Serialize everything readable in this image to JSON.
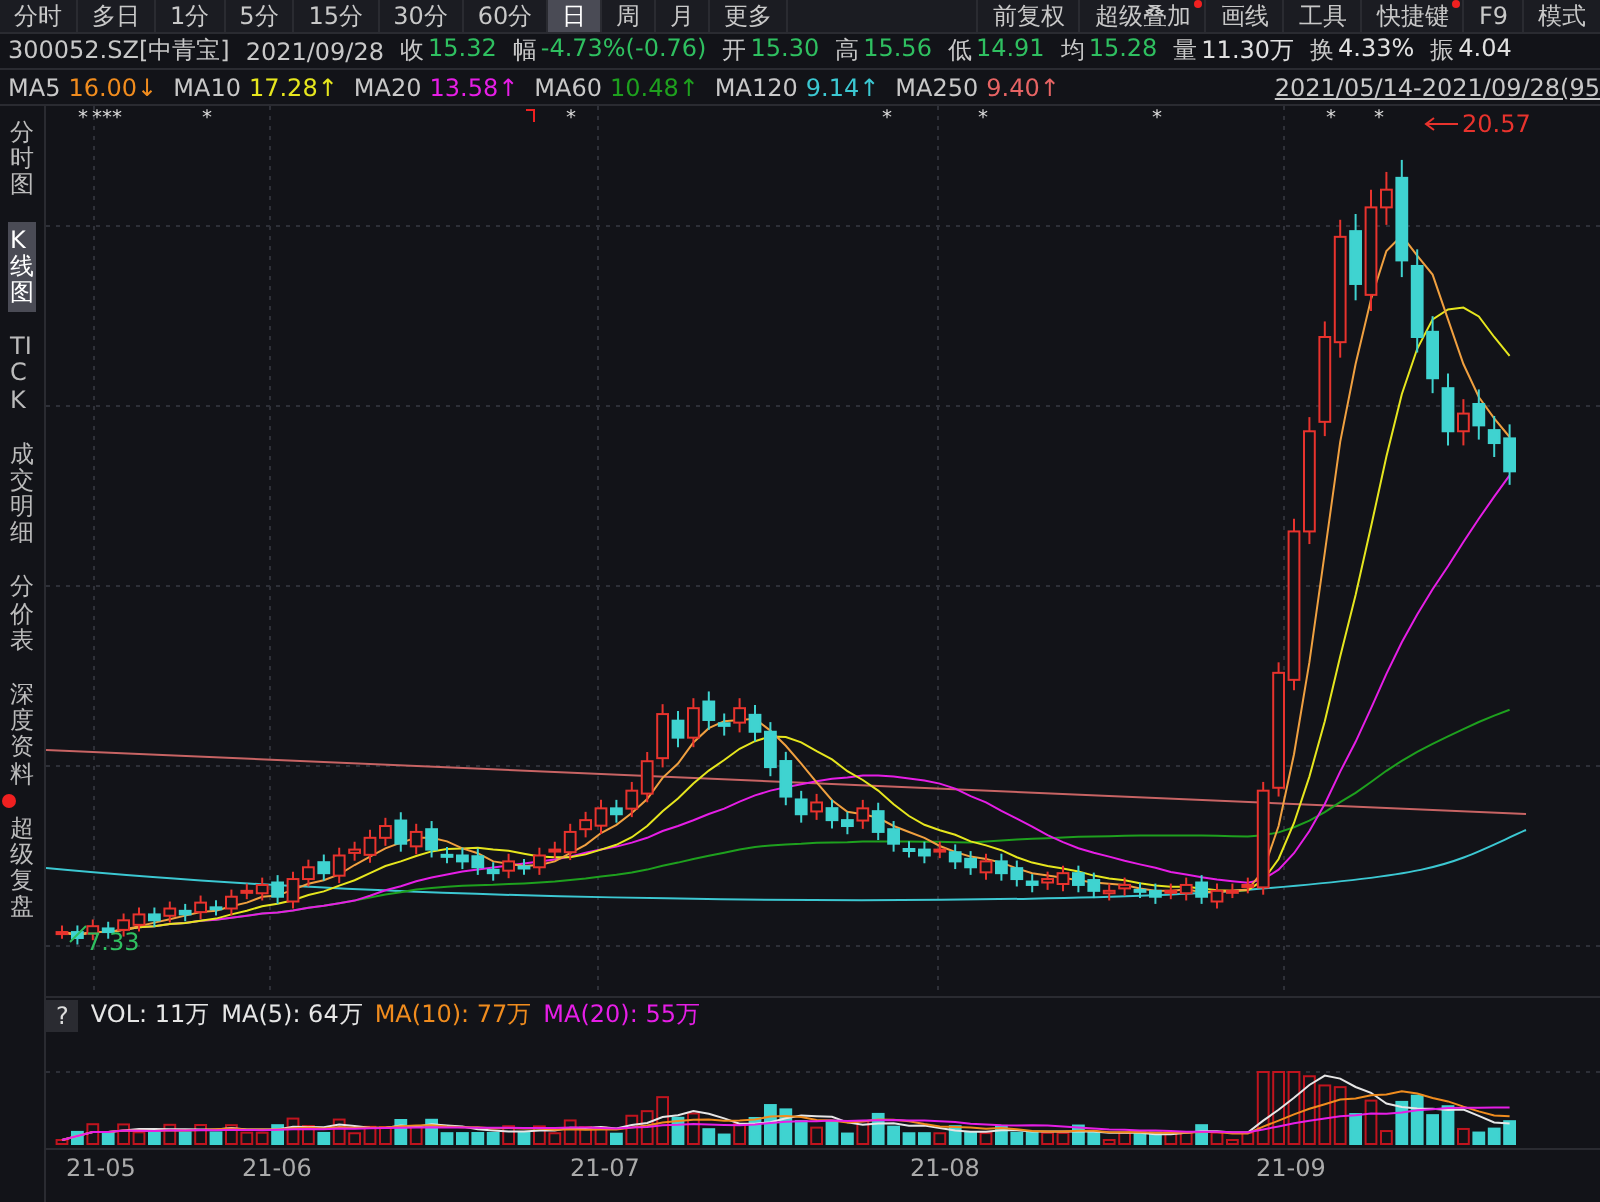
{
  "period_tabs": [
    {
      "label": "分时",
      "selected": false
    },
    {
      "label": "多日",
      "selected": false
    },
    {
      "label": "1分",
      "selected": false
    },
    {
      "label": "5分",
      "selected": false
    },
    {
      "label": "15分",
      "selected": false
    },
    {
      "label": "30分",
      "selected": false
    },
    {
      "label": "60分",
      "selected": false
    },
    {
      "label": "日",
      "selected": true
    },
    {
      "label": "周",
      "selected": false
    },
    {
      "label": "月",
      "selected": false
    },
    {
      "label": "更多",
      "selected": false
    }
  ],
  "tools": [
    {
      "label": "前复权",
      "badge": false
    },
    {
      "label": "超级叠加",
      "badge": true
    },
    {
      "label": "画线",
      "badge": false
    },
    {
      "label": "工具",
      "badge": false
    },
    {
      "label": "快捷键",
      "badge": true
    },
    {
      "label": "F9",
      "badge": false
    },
    {
      "label": "模式",
      "badge": false
    }
  ],
  "quote": {
    "symbol": "300052.SZ[中青宝]",
    "date": "2021/09/28",
    "fields": [
      {
        "label": "收",
        "value": "15.32",
        "color": "#2fbf60"
      },
      {
        "label": "幅",
        "value": "-4.73%(-0.76)",
        "color": "#2fbf60"
      },
      {
        "label": "开",
        "value": "15.30",
        "color": "#2fbf60"
      },
      {
        "label": "高",
        "value": "15.56",
        "color": "#2fbf60"
      },
      {
        "label": "低",
        "value": "14.91",
        "color": "#2fbf60"
      },
      {
        "label": "均",
        "value": "15.28",
        "color": "#2fbf60"
      },
      {
        "label": "量",
        "value": "11.30万",
        "color": "#e0e0e0"
      },
      {
        "label": "换",
        "value": "4.33%",
        "color": "#e0e0e0"
      },
      {
        "label": "振",
        "value": "4.04",
        "color": "#e0e0e0"
      }
    ]
  },
  "moving_averages": [
    {
      "label": "MA5",
      "value": "16.00↓",
      "color": "#f08c1e"
    },
    {
      "label": "MA10",
      "value": "17.28↑",
      "color": "#e6e61e"
    },
    {
      "label": "MA20",
      "value": "13.58↑",
      "color": "#e61ee6"
    },
    {
      "label": "MA60",
      "value": "10.48↑",
      "color": "#1ea01e"
    },
    {
      "label": "MA120",
      "value": "9.14↑",
      "color": "#3cc8d2"
    },
    {
      "label": "MA250",
      "value": "9.40↑",
      "color": "#e66464"
    }
  ],
  "date_range": "2021/05/14-2021/09/28(95",
  "event_markers": [
    "*",
    "*",
    "*",
    "*",
    "*",
    "*",
    "*",
    "*",
    "*",
    "*",
    "*"
  ],
  "side_tabs": [
    {
      "label": "分时图",
      "selected": false,
      "dot": false
    },
    {
      "label": "K线图",
      "selected": true,
      "dot": false
    },
    {
      "label": "TICK",
      "selected": false,
      "dot": false
    },
    {
      "label": "成交明细",
      "selected": false,
      "dot": false
    },
    {
      "label": "分价表",
      "selected": false,
      "dot": false
    },
    {
      "label": "深度资料",
      "selected": false,
      "dot": false
    },
    {
      "label": "超级复盘",
      "selected": false,
      "dot": true
    }
  ],
  "price_chart": {
    "high_label": "20.57",
    "low_label": "7.33"
  },
  "volume": {
    "help": "?",
    "items": [
      {
        "text": "VOL: 11万",
        "color": "#e6e6e6"
      },
      {
        "text": "MA(5): 64万",
        "color": "#e6e6e6"
      },
      {
        "text": "MA(10): 77万",
        "color": "#f08c1e"
      },
      {
        "text": "MA(20): 55万",
        "color": "#e61ee6"
      }
    ]
  },
  "x_axis": [
    "21-05",
    "21-06",
    "21-07",
    "21-08",
    "21-09"
  ]
}
